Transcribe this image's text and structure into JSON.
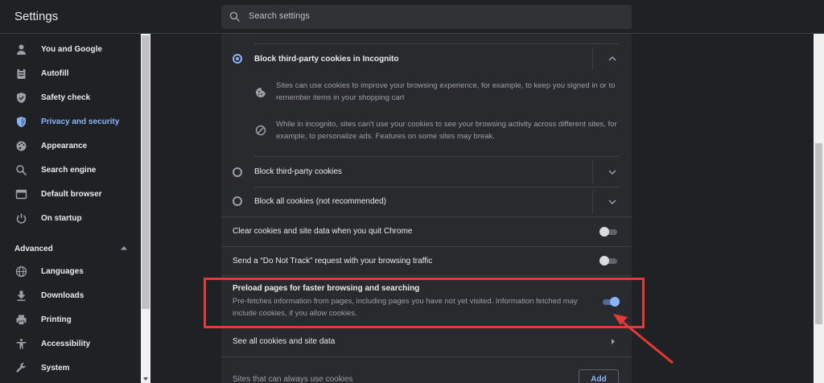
{
  "header": {
    "title": "Settings",
    "search_placeholder": "Search settings"
  },
  "sidebar": {
    "items": [
      {
        "label": "You and Google",
        "icon": "person-icon"
      },
      {
        "label": "Autofill",
        "icon": "clipboard-icon"
      },
      {
        "label": "Safety check",
        "icon": "shield-check-icon"
      },
      {
        "label": "Privacy and security",
        "icon": "shield-icon",
        "active": true
      },
      {
        "label": "Appearance",
        "icon": "palette-icon"
      },
      {
        "label": "Search engine",
        "icon": "search-icon"
      },
      {
        "label": "Default browser",
        "icon": "browser-icon"
      },
      {
        "label": "On startup",
        "icon": "power-icon"
      }
    ],
    "advanced_label": "Advanced",
    "advanced_items": [
      {
        "label": "Languages",
        "icon": "globe-icon"
      },
      {
        "label": "Downloads",
        "icon": "download-icon"
      },
      {
        "label": "Printing",
        "icon": "printer-icon"
      },
      {
        "label": "Accessibility",
        "icon": "accessibility-icon"
      },
      {
        "label": "System",
        "icon": "wrench-icon"
      }
    ]
  },
  "cookies": {
    "incognito": {
      "label": "Block third-party cookies in Incognito",
      "checked": true,
      "detail_1": "Sites can use cookies to improve your browsing experience, for example, to keep you signed in or to remember items in your shopping cart",
      "detail_2": "While in incognito, sites can't use your cookies to see your browsing activity across different sites, for example, to personalize ads. Features on some sites may break."
    },
    "third_party": {
      "label": "Block third-party cookies",
      "checked": false
    },
    "all": {
      "label": "Block all cookies (not recommended)",
      "checked": false
    }
  },
  "settings": {
    "clear_on_quit": {
      "label": "Clear cookies and site data when you quit Chrome",
      "enabled": false
    },
    "do_not_track": {
      "label": "Send a “Do Not Track” request with your browsing traffic",
      "enabled": false
    },
    "preload": {
      "label": "Preload pages for faster browsing and searching",
      "description": "Pre-fetches information from pages, including pages you have not yet visited. Information fetched may include cookies, if you allow cookies.",
      "enabled": true
    },
    "see_all_label": "See all cookies and site data",
    "always_use_label": "Sites that can always use cookies",
    "add_label": "Add"
  },
  "colors": {
    "accent": "#8ab4f8",
    "highlight": "#e53935",
    "background": "#202124",
    "card": "#292a2d"
  }
}
